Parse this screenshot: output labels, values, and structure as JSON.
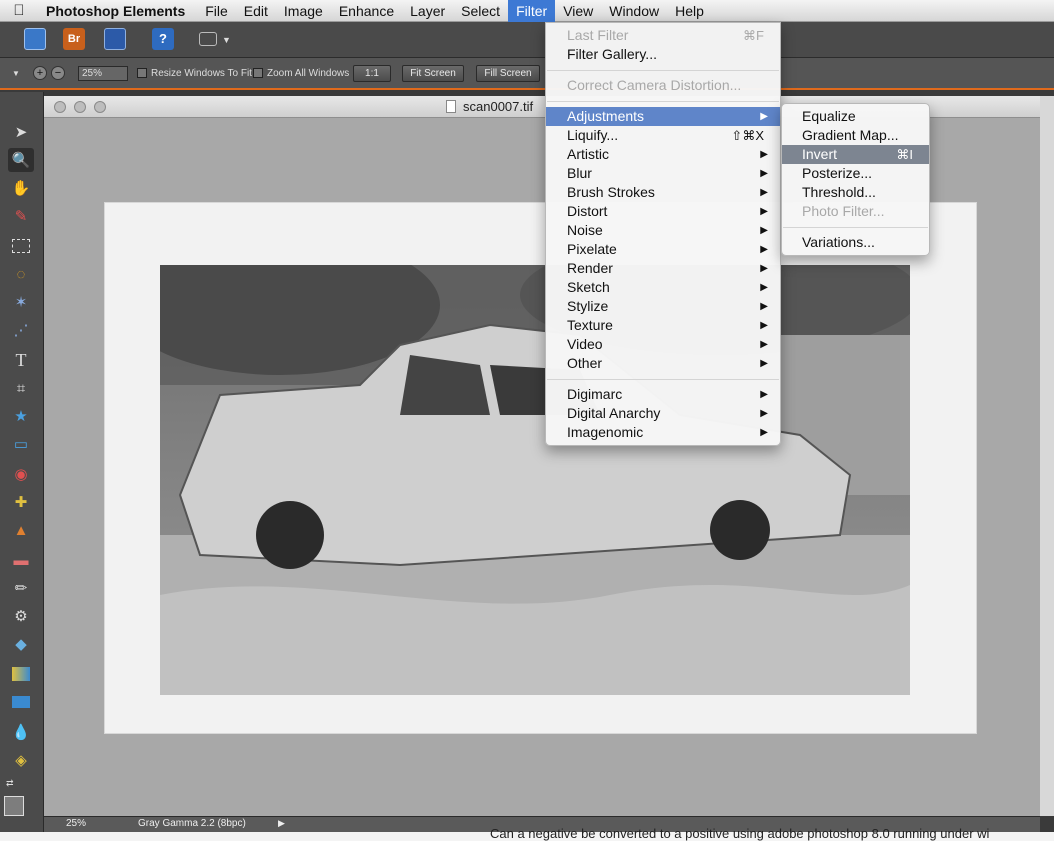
{
  "menubar": {
    "app_name": "Photoshop Elements",
    "items": [
      "File",
      "Edit",
      "Image",
      "Enhance",
      "Layer",
      "Select",
      "Filter",
      "View",
      "Window",
      "Help"
    ]
  },
  "toolbar": {
    "br_label": "Br",
    "help_label": "?",
    "zoom_value": "25%",
    "resize_windows": "Resize Windows To Fit",
    "zoom_all_windows": "Zoom All Windows",
    "actual_pixels": "1:1",
    "fit_screen": "Fit Screen",
    "fill_screen": "Fill Screen"
  },
  "document": {
    "title": "scan0007.tif",
    "zoom": "25%",
    "profile": "Gray Gamma 2.2 (8bpc)"
  },
  "filter_menu": {
    "last_filter": "Last Filter",
    "last_filter_shortcut": "⌘F",
    "filter_gallery": "Filter Gallery...",
    "correct_camera": "Correct Camera Distortion...",
    "adjustments": "Adjustments",
    "liquify": "Liquify...",
    "liquify_shortcut": "⇧⌘X",
    "artistic": "Artistic",
    "blur": "Blur",
    "brush_strokes": "Brush Strokes",
    "distort": "Distort",
    "noise": "Noise",
    "pixelate": "Pixelate",
    "render": "Render",
    "sketch": "Sketch",
    "stylize": "Stylize",
    "texture": "Texture",
    "video": "Video",
    "other": "Other",
    "digimarc": "Digimarc",
    "digital_anarchy": "Digital Anarchy",
    "imagenomic": "Imagenomic"
  },
  "adjustments_menu": {
    "equalize": "Equalize",
    "gradient_map": "Gradient Map...",
    "invert": "Invert",
    "invert_shortcut": "⌘I",
    "posterize": "Posterize...",
    "threshold": "Threshold...",
    "photo_filter": "Photo Filter...",
    "variations": "Variations..."
  },
  "background_text": "Can a negative be converted to a positive using adobe photoshop 8.0 running under wi"
}
